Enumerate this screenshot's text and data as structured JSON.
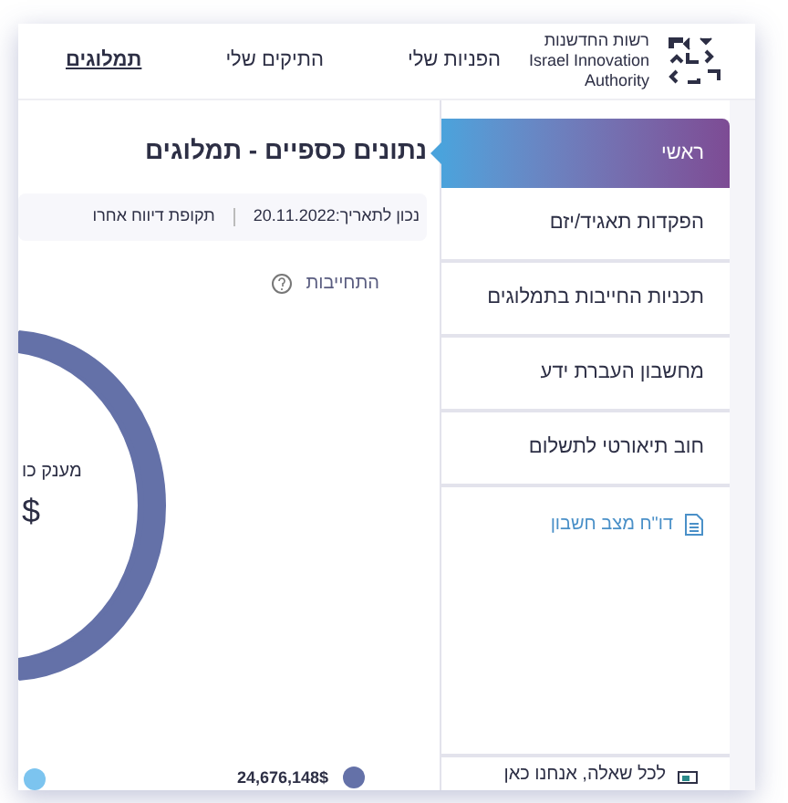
{
  "header": {
    "logo": {
      "hebrew": "רשות החדשנות",
      "english_1": "Israel Innovation",
      "english_2": "Authority"
    },
    "nav": [
      {
        "label": "הפניות שלי",
        "selected": false
      },
      {
        "label": "התיקים שלי",
        "selected": false
      },
      {
        "label": "תמלוגים",
        "selected": true
      }
    ]
  },
  "sidebar": {
    "items": [
      {
        "label": "ראשי",
        "selected": true
      },
      {
        "label": "הפקדות תאגיד/יזם",
        "selected": false
      },
      {
        "label": "תכניות החייבות בתמלוגים",
        "selected": false
      },
      {
        "label": "מחשבון העברת ידע",
        "selected": false
      },
      {
        "label": "חוב תיאורטי לתשלום",
        "selected": false
      }
    ],
    "report_link": "דו\"ח מצב חשבון",
    "help": "לכל שאלה, אנחנו כאן"
  },
  "main": {
    "title": "נתונים כספיים - תמלוגים",
    "date": "נכון לתאריך:20.11.2022",
    "period": "תקופת דיווח אחרו",
    "commitment": "התחייבות",
    "donut": {
      "label": "מענק כו",
      "currency": "$"
    },
    "legend": [
      {
        "value": "24,676,148$",
        "color": "#6471a8"
      },
      {
        "color": "#7cc4ef"
      }
    ]
  }
}
